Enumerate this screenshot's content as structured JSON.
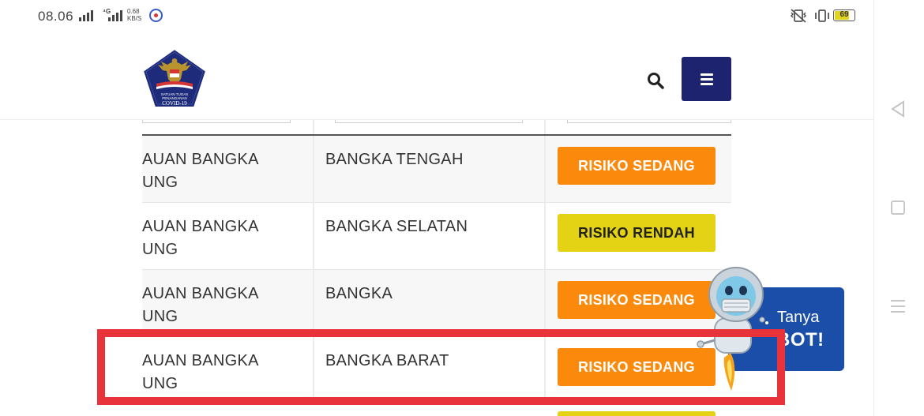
{
  "status_bar": {
    "time": "08.06",
    "network_type": "⁴G",
    "net_speed_value": "0.68",
    "net_speed_unit": "KB/S",
    "battery": "69",
    "battery_level": 0.69
  },
  "header": {
    "logo_icon": "garuda-covid19-logo",
    "logo_text_1": "SATUAN TUGAS",
    "logo_text_2": "PENANGANAN",
    "logo_text_3": "COVID-19",
    "search_icon": "search-icon",
    "menu_icon": "hamburger-icon"
  },
  "table": {
    "rows": [
      {
        "province_line1": "AUAN BANGKA",
        "province_line2": "UNG",
        "kabupaten": "BANGKA TENGAH",
        "risk": "RISIKO SEDANG",
        "risk_color": "#fb8a0c"
      },
      {
        "province_line1": "AUAN BANGKA",
        "province_line2": "UNG",
        "kabupaten": "BANGKA SELATAN",
        "risk": "RISIKO RENDAH",
        "risk_color": "#e3d314"
      },
      {
        "province_line1": "AUAN BANGKA",
        "province_line2": "UNG",
        "kabupaten": "BANGKA",
        "risk": "RISIKO SEDANG",
        "risk_color": "#fb8a0c"
      },
      {
        "province_line1": "AUAN BANGKA",
        "province_line2": "UNG",
        "kabupaten": "BANGKA BARAT",
        "risk": "RISIKO SEDANG",
        "risk_color": "#fb8a0c"
      }
    ]
  },
  "chatbot": {
    "line1": "Tanya",
    "line2": "BOT!"
  },
  "colors": {
    "navy": "#1e2370",
    "orange": "#fb8a0c",
    "yellow": "#e3d314",
    "highlight": "#e8333a",
    "bot_blue": "#1b4ea8"
  }
}
